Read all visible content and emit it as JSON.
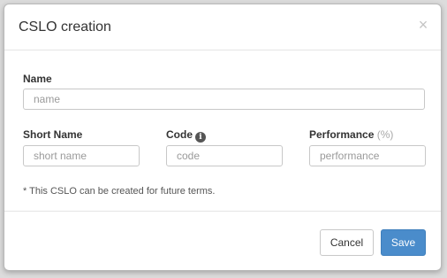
{
  "dialog": {
    "title": "CSLO creation",
    "close_icon": "close-icon",
    "close_glyph": "×"
  },
  "form": {
    "name": {
      "label": "Name",
      "placeholder": "name",
      "value": ""
    },
    "short_name": {
      "label": "Short Name",
      "placeholder": "short name",
      "value": ""
    },
    "code": {
      "label": "Code",
      "info_icon": "info-icon",
      "info_glyph": "i",
      "placeholder": "code",
      "value": ""
    },
    "performance": {
      "label": "Performance",
      "unit": "(%)",
      "placeholder": "performance",
      "value": ""
    },
    "note": "* This CSLO can be created for future terms."
  },
  "footer": {
    "cancel_label": "Cancel",
    "save_label": "Save"
  },
  "colors": {
    "primary": "#4a8ccb",
    "text": "#333333",
    "muted": "#a8a8a8"
  }
}
